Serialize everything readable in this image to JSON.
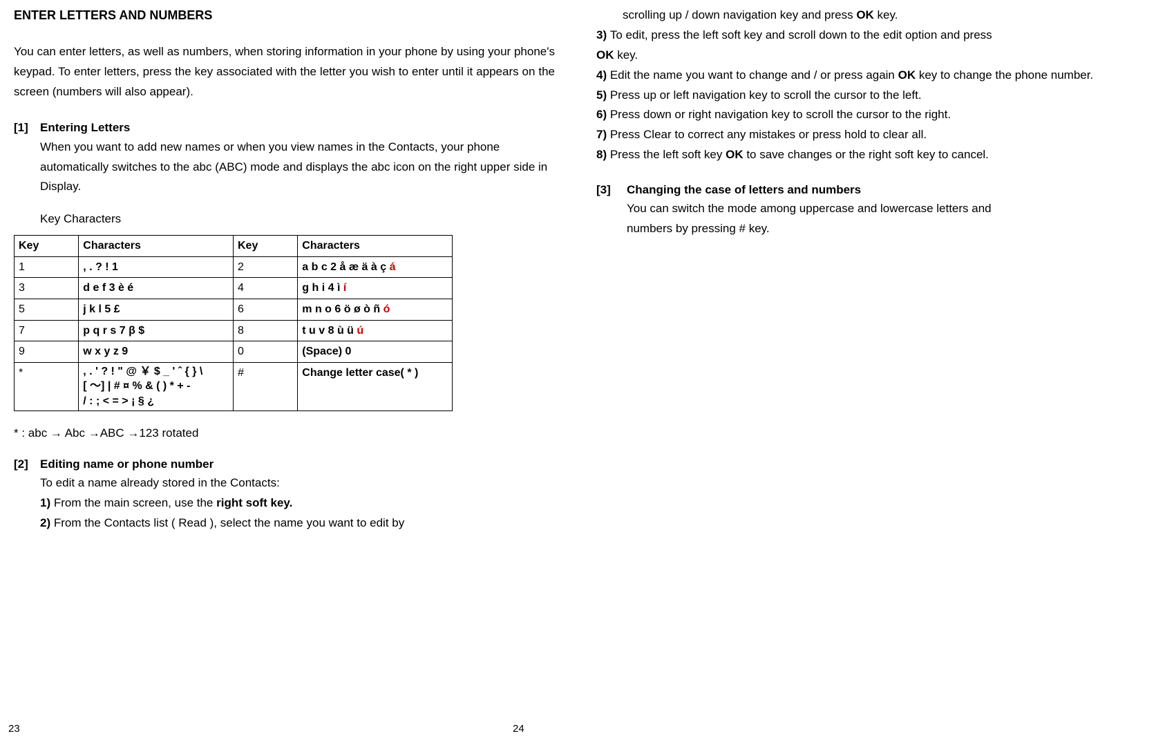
{
  "left": {
    "title": "ENTER LETTERS AND NUMBERS",
    "intro": "You can enter letters, as well as numbers, when storing information in your phone by using your phone's keypad. To enter letters, press the key associated with the letter you wish to enter until it appears on the screen (numbers will also appear).",
    "s1": {
      "num": "[1]",
      "title": "Entering Letters",
      "body": "When you want to add new names or when you view names in the Contacts, your phone automatically switches to the abc (ABC) mode and displays the abc icon on the right upper side in Display.",
      "keychars_label": "Key Characters"
    },
    "table": {
      "h_key": "Key",
      "h_chars": "Characters",
      "rows": [
        {
          "k1": "1",
          "c1": ", . ? ! 1",
          "k2": "2",
          "c2": "a b c 2 å æ ä à ç ",
          "c2r": "á"
        },
        {
          "k1": "3",
          "c1": "d e f 3 è é",
          "k2": "4",
          "c2": "g h i 4 ì ",
          "c2r": "í"
        },
        {
          "k1": "5",
          "c1": "j k l 5 £",
          "k2": "6",
          "c2": "m n o 6 ö ø ò ñ ",
          "c2r": "ó"
        },
        {
          "k1": "7",
          "c1": "p q r s 7  β  $",
          "k2": "8",
          "c2": "t u v 8 ù ü ",
          "c2r": "ú"
        },
        {
          "k1": "9",
          "c1": "w x y z 9",
          "k2": "0",
          "c2": "(Space) 0",
          "c2r": ""
        }
      ],
      "lastrow": {
        "k1": "*",
        "c1_l1": ", . ' ? ! \" @  ￥  $ _ ' ˆ { } \\",
        "c1_l2": "[  ～] | # ¤ % & ( ) * + -",
        "c1_l3": "/ : ; < = > ¡  §   ¿",
        "k2": "#",
        "c2": "Change letter case( * )"
      }
    },
    "footnote": "* : abc → Abc →ABC →123 rotated",
    "s2": {
      "num": "[2]",
      "title": "Editing name or phone number",
      "intro": "To edit a name already stored in the Contacts:",
      "step1_pre": "1) ",
      "step1_a": "From the main screen, use the ",
      "step1_b": "right soft key.",
      "step2_pre": "2) ",
      "step2": "From the Contacts list ( Read ), select the name you want to edit by"
    },
    "page_num": "23"
  },
  "right": {
    "cont": "scrolling up / down navigation key and press ",
    "cont_bold": "OK",
    "cont_tail": " key.",
    "step3_pre": "3) ",
    "step3_a": "To edit, press the left soft key and scroll down to the edit option and press ",
    "step3_b": "OK",
    "step3_c": " key.",
    "step4_pre": "4) ",
    "step4_a": "Edit the name you want to change and / or press again ",
    "step4_b": "OK",
    "step4_c": " key to change the phone number.",
    "step5_pre": "5) ",
    "step5": "Press up or left navigation key to scroll the cursor to the left.",
    "step6_pre": "6) ",
    "step6": "Press down or right navigation key to scroll the cursor to the right.",
    "step7_pre": "7) ",
    "step7": "Press Clear to correct any mistakes or press hold to clear all.",
    "step8_pre": "8) ",
    "step8_a": "Press the left soft key ",
    "step8_b": "OK",
    "step8_c": " to save changes or the right soft key to cancel.",
    "s3": {
      "num": "[3]",
      "title": "Changing the case of letters and numbers",
      "body1": "You can switch the mode among uppercase and lowercase letters and",
      "body2": "numbers by pressing # key."
    },
    "page_num": "24"
  }
}
